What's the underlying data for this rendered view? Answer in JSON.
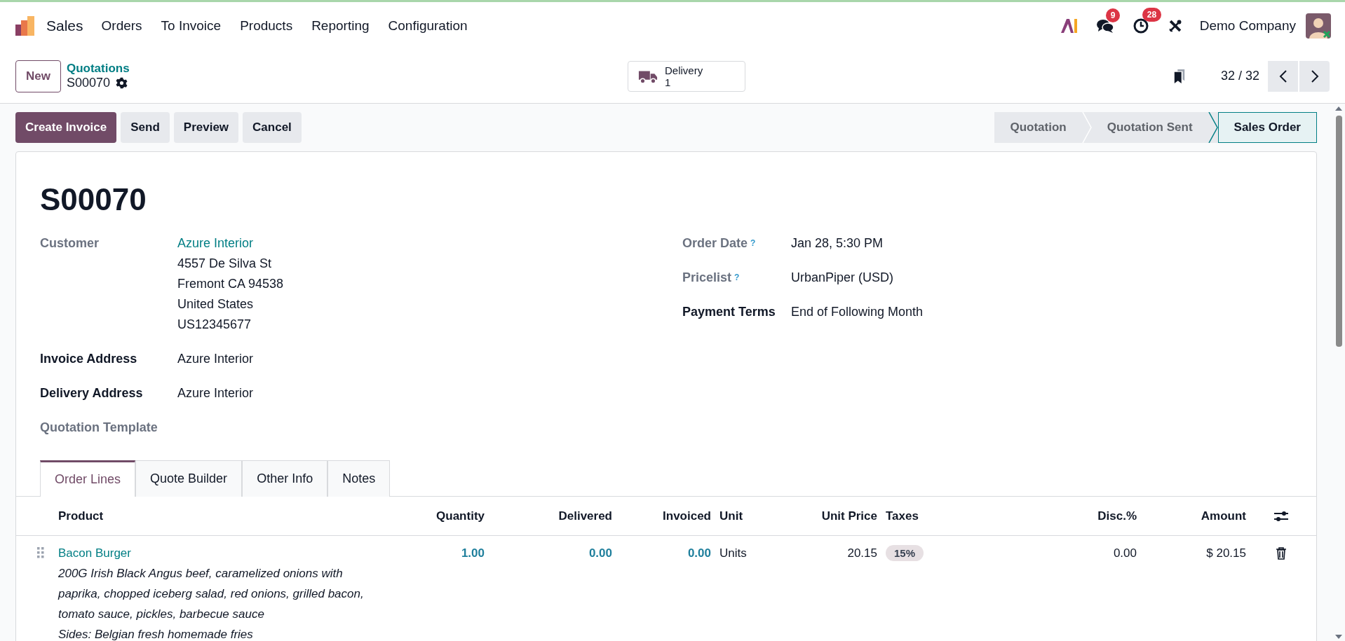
{
  "navbar": {
    "app": "Sales",
    "menus": [
      "Orders",
      "To Invoice",
      "Products",
      "Reporting",
      "Configuration"
    ],
    "systray": [
      {
        "kind": "ai"
      },
      {
        "kind": "chat",
        "badge": "9"
      },
      {
        "kind": "activity",
        "badge": "28"
      },
      {
        "kind": "tools"
      }
    ],
    "company": "Demo Company"
  },
  "control_panel": {
    "new_button": "New",
    "breadcrumb": "Quotations",
    "record": "S00070",
    "smart_button": {
      "label": "Delivery",
      "count": "1"
    },
    "pager": "32 / 32"
  },
  "actions": [
    {
      "label": "Create Invoice",
      "primary": true
    },
    {
      "label": "Send",
      "primary": false
    },
    {
      "label": "Preview",
      "primary": false
    },
    {
      "label": "Cancel",
      "primary": false
    }
  ],
  "statusbar": [
    {
      "label": "Quotation",
      "selected": false
    },
    {
      "label": "Quotation Sent",
      "selected": false
    },
    {
      "label": "Sales Order",
      "selected": true
    }
  ],
  "form": {
    "title": "S00070",
    "left_fields": [
      {
        "label": "Customer",
        "muted": true,
        "link": "Azure Interior",
        "lines": [
          "4557 De Silva St",
          "Fremont CA 94538",
          "United States",
          "US12345677"
        ]
      },
      {
        "label": "Invoice Address",
        "muted": false,
        "lines": [
          "Azure Interior"
        ]
      },
      {
        "label": "Delivery Address",
        "muted": false,
        "lines": [
          "Azure Interior"
        ]
      },
      {
        "label": "Quotation Template",
        "muted": true
      }
    ],
    "right_fields": [
      {
        "label": "Order Date",
        "help": "?",
        "muted": true,
        "lines": [
          "Jan 28, 5:30 PM"
        ]
      },
      {
        "label": "Pricelist",
        "help": "?",
        "muted": true,
        "lines": [
          "UrbanPiper (USD)"
        ]
      },
      {
        "label": "Payment Terms",
        "muted": false,
        "lines": [
          "End of Following Month"
        ]
      }
    ],
    "tabs": [
      {
        "label": "Order Lines",
        "selected": true
      },
      {
        "label": "Quote Builder",
        "selected": false
      },
      {
        "label": "Other Info",
        "selected": false
      },
      {
        "label": "Notes",
        "selected": false
      }
    ],
    "table": {
      "columns": [
        "Product",
        "Quantity",
        "Delivered",
        "Invoiced",
        "Unit",
        "Unit Price",
        "Taxes",
        "Disc.%",
        "Amount"
      ],
      "rows": [
        {
          "product": "Bacon Burger",
          "description": [
            "200G Irish Black Angus beef, caramelized onions with",
            "paprika, chopped iceberg salad, red onions, grilled bacon,",
            "tomato sauce, pickles, barbecue sauce",
            "Sides: Belgian fresh homemade fries"
          ],
          "quantity": "1.00",
          "delivered": "0.00",
          "invoiced": "0.00",
          "unit": "Units",
          "unit_price": "20.15",
          "taxes": [
            "15%"
          ],
          "discount": "0.00",
          "amount": "$ 20.15"
        }
      ]
    }
  }
}
